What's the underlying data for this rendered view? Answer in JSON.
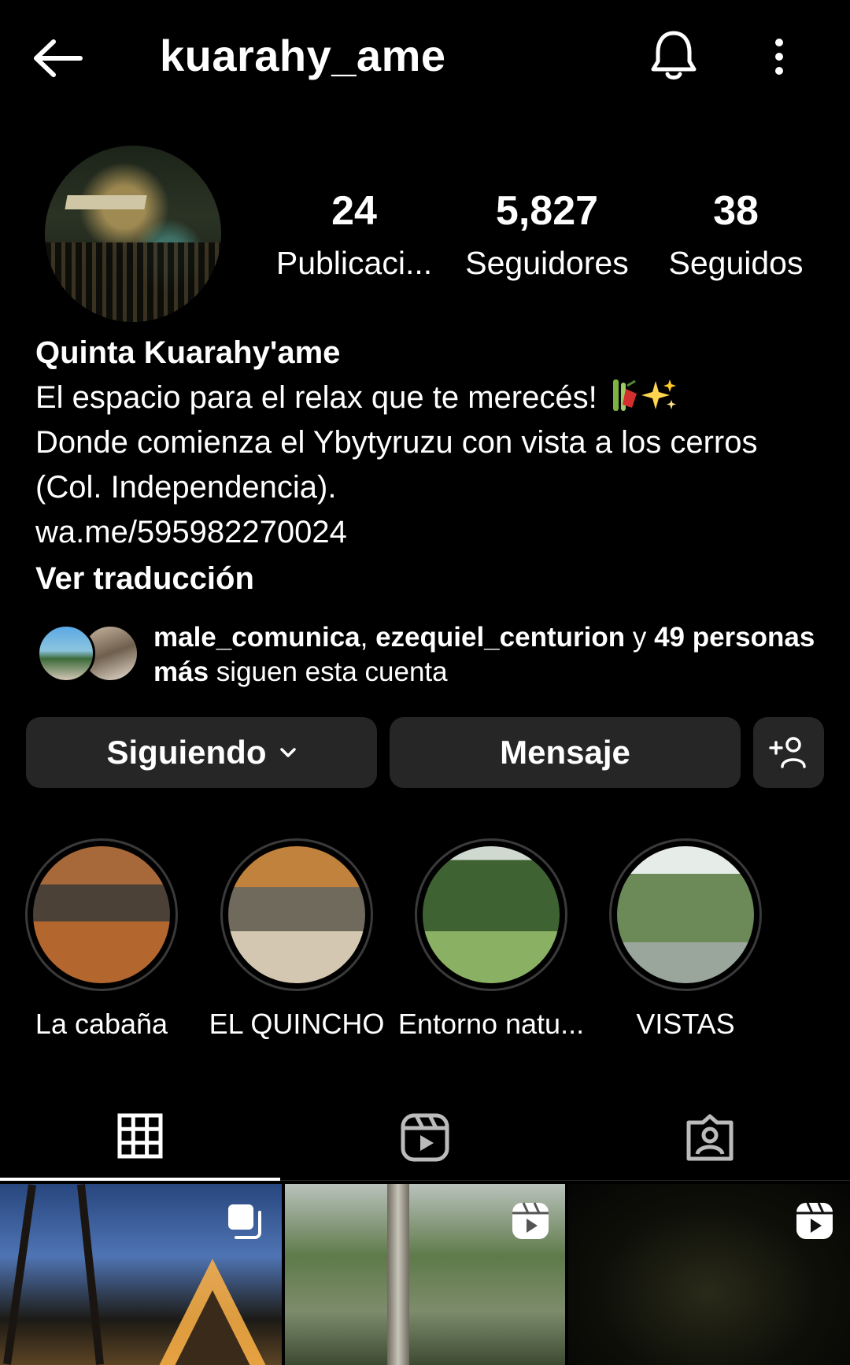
{
  "header": {
    "username": "kuarahy_ame"
  },
  "stats": {
    "posts_count": "24",
    "posts_label": "Publicaci...",
    "followers_count": "5,827",
    "followers_label": "Seguidores",
    "following_count": "38",
    "following_label": "Seguidos"
  },
  "bio": {
    "name": "Quinta Kuarahy'ame",
    "line1": "El espacio para el relax que te merecés!",
    "line2": "Donde comienza el Ybytyruzu con vista a los cerros",
    "line3": "(Col. Independencia).",
    "link": "wa.me/595982270024",
    "translate_label": "Ver traducción"
  },
  "followed_by": {
    "user1": "male_comunica",
    "sep": ", ",
    "user2": "ezequiel_centurion",
    "conj": " y ",
    "others": "49 personas más",
    "suffix": " siguen esta cuenta"
  },
  "buttons": {
    "following_label": "Siguiendo",
    "message_label": "Mensaje"
  },
  "highlights": [
    {
      "label": "La cabaña"
    },
    {
      "label": "EL QUINCHO"
    },
    {
      "label": "Entorno natu..."
    },
    {
      "label": "VISTAS"
    }
  ],
  "tabs": [
    {
      "icon": "grid-icon",
      "active": true
    },
    {
      "icon": "reels-icon",
      "active": false
    },
    {
      "icon": "tagged-icon",
      "active": false
    }
  ],
  "posts": [
    {
      "badge": "carousel-icon"
    },
    {
      "badge": "reel-icon"
    },
    {
      "badge": "reel-icon"
    }
  ],
  "colors": {
    "background": "#000000",
    "button_bg": "#262626",
    "text": "#ffffff"
  }
}
